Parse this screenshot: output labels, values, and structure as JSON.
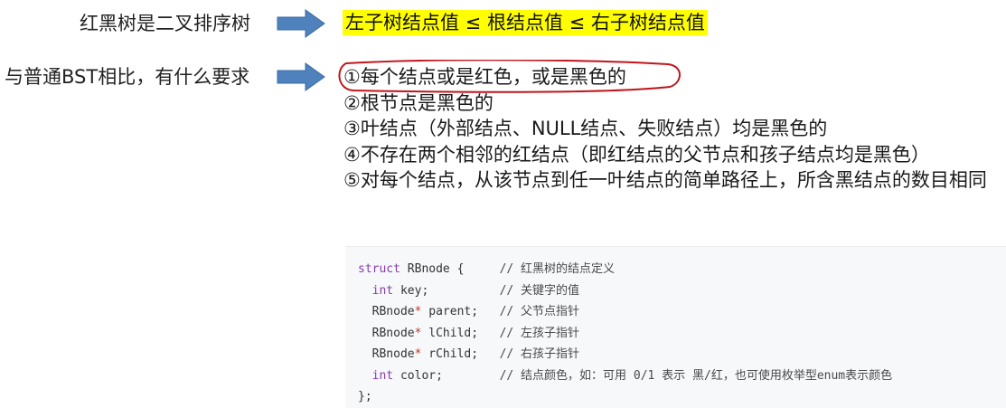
{
  "row1": {
    "question": "红黑树是二叉排序树",
    "answer": "左子树结点值 ≤ 根结点值 ≤ 右子树结点值"
  },
  "row2": {
    "question": "与普通BST相比，有什么要求",
    "rules": [
      "①每个结点或是红色，或是黑色的",
      "②根节点是黑色的",
      "③叶结点（外部结点、NULL结点、失败结点）均是黑色的",
      "④不存在两个相邻的红结点（即红结点的父节点和孩子结点均是黑色）",
      "⑤对每个结点，从该节点到任一叶结点的简单路径上，所含黑结点的数目相同"
    ]
  },
  "code": {
    "lines": [
      {
        "kw": "struct",
        "rest": " RBnode {",
        "pad": "     ",
        "comment": "// 红黑树的结点定义"
      },
      {
        "indent": "  ",
        "kw": "int",
        "rest": " key;",
        "pad": "          ",
        "comment": "// 关键字的值"
      },
      {
        "indent": "  ",
        "type": "RBnode",
        "ptr": "*",
        "rest": " parent;",
        "pad": "   ",
        "comment": "// 父节点指针"
      },
      {
        "indent": "  ",
        "type": "RBnode",
        "ptr": "*",
        "rest": " lChild;",
        "pad": "   ",
        "comment": "// 左孩子指针"
      },
      {
        "indent": "  ",
        "type": "RBnode",
        "ptr": "*",
        "rest": " rChild;",
        "pad": "   ",
        "comment": "// 右孩子指针"
      },
      {
        "indent": "  ",
        "kw": "int",
        "rest": " color;",
        "pad": "        ",
        "comment": "// 结点颜色，如：可用 0/1 表示 黑/红，也可使用枚举型enum表示颜色"
      },
      {
        "rest": "};"
      }
    ]
  },
  "colors": {
    "highlight": "#ffff00",
    "arrow": "#4f81bd",
    "ring": "#c0151b"
  }
}
